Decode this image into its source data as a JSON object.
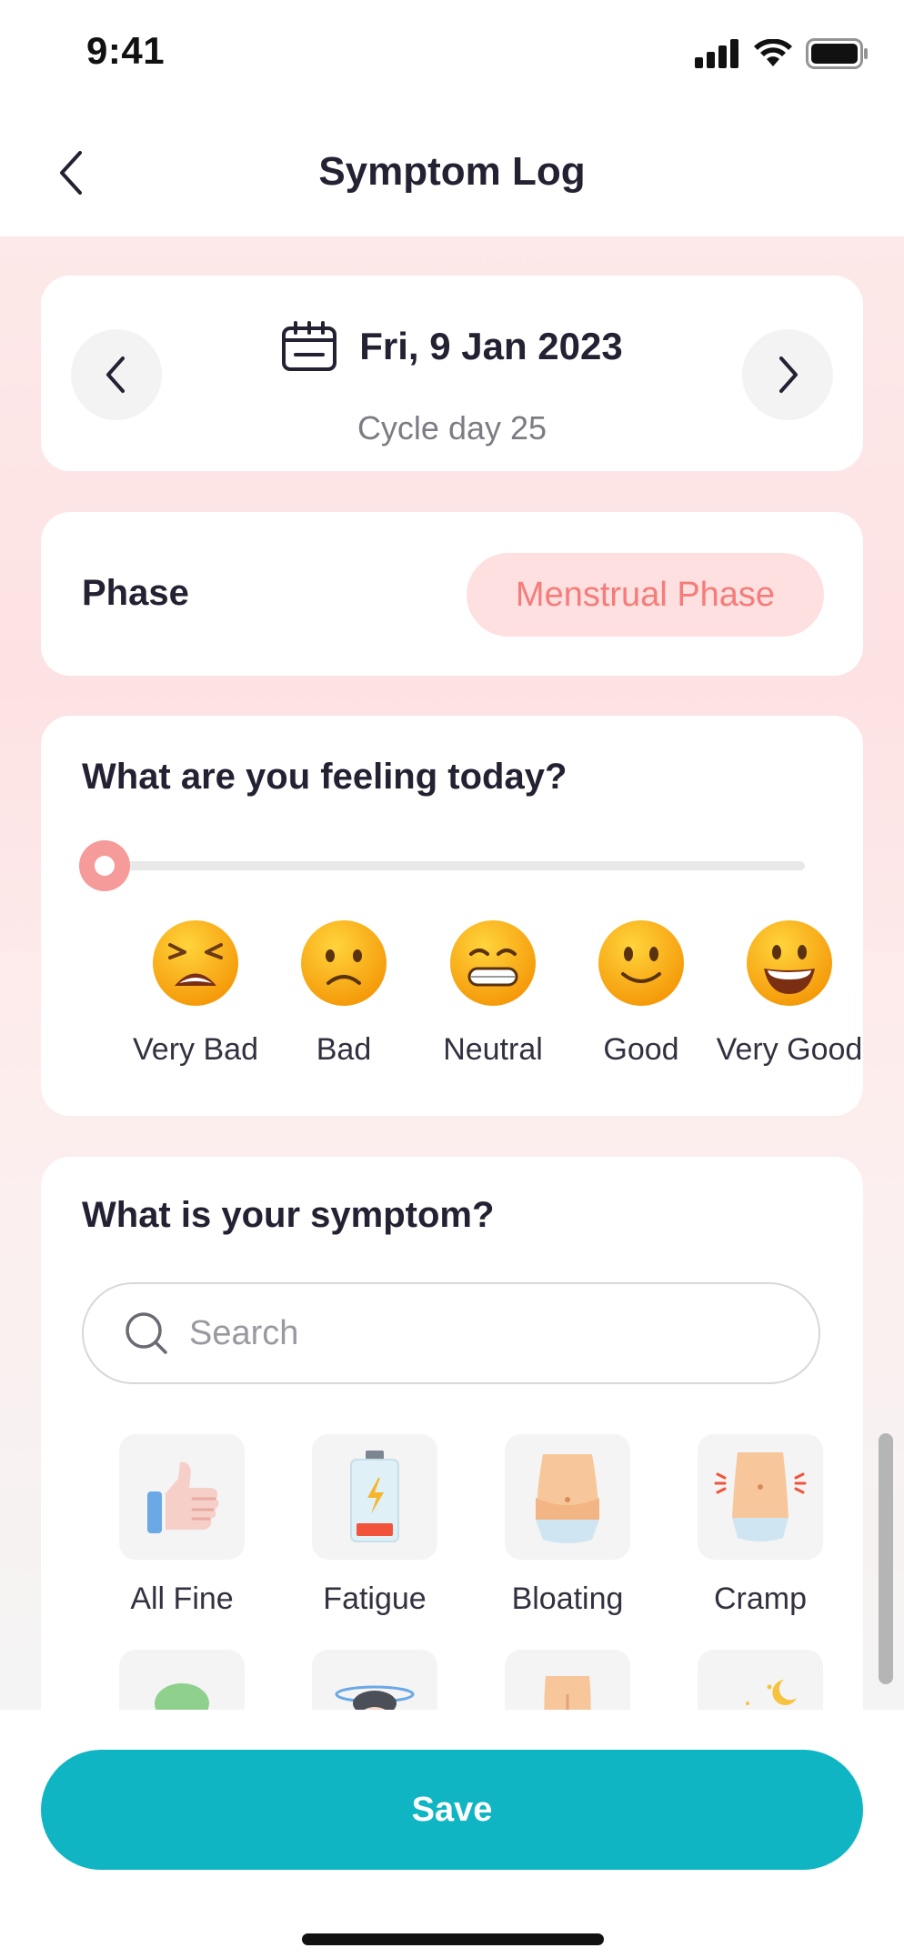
{
  "status_bar": {
    "time": "9:41"
  },
  "header": {
    "title": "Symptom Log",
    "back_icon": "chevron-left-icon"
  },
  "date": {
    "label": "Fri, 9 Jan 2023",
    "cycle_day": "Cycle day 25",
    "icon": "calendar-icon"
  },
  "phase": {
    "label": "Phase",
    "value": "Menstrual Phase"
  },
  "feeling": {
    "heading": "What are you feeling today?",
    "selected": "Very Bad",
    "slider_value_fraction": 0,
    "moods": [
      {
        "label": "Very Bad",
        "icon": "very-bad-emoji-icon"
      },
      {
        "label": "Bad",
        "icon": "bad-emoji-icon"
      },
      {
        "label": "Neutral",
        "icon": "neutral-emoji-icon"
      },
      {
        "label": "Good",
        "icon": "good-emoji-icon"
      },
      {
        "label": "Very Good",
        "icon": "very-good-emoji-icon"
      }
    ]
  },
  "symptoms": {
    "heading": "What is your symptom?",
    "search_placeholder": "Search",
    "items": [
      {
        "label": "All Fine",
        "icon": "thumbs-up-icon"
      },
      {
        "label": "Fatigue",
        "icon": "low-battery-icon"
      },
      {
        "label": "Bloating",
        "icon": "bloated-belly-icon"
      },
      {
        "label": "Cramp",
        "icon": "cramp-belly-icon"
      }
    ],
    "partial_row_icons": [
      "towel-head-icon",
      "dizzy-face-icon",
      "back-icon",
      "night-sleep-icon"
    ]
  },
  "actions": {
    "save_label": "Save"
  },
  "colors": {
    "accent": "#0fb5c2",
    "phase_pill_bg": "#fde0df",
    "phase_pill_text": "#f57c7a",
    "slider_thumb": "#f59b99"
  }
}
